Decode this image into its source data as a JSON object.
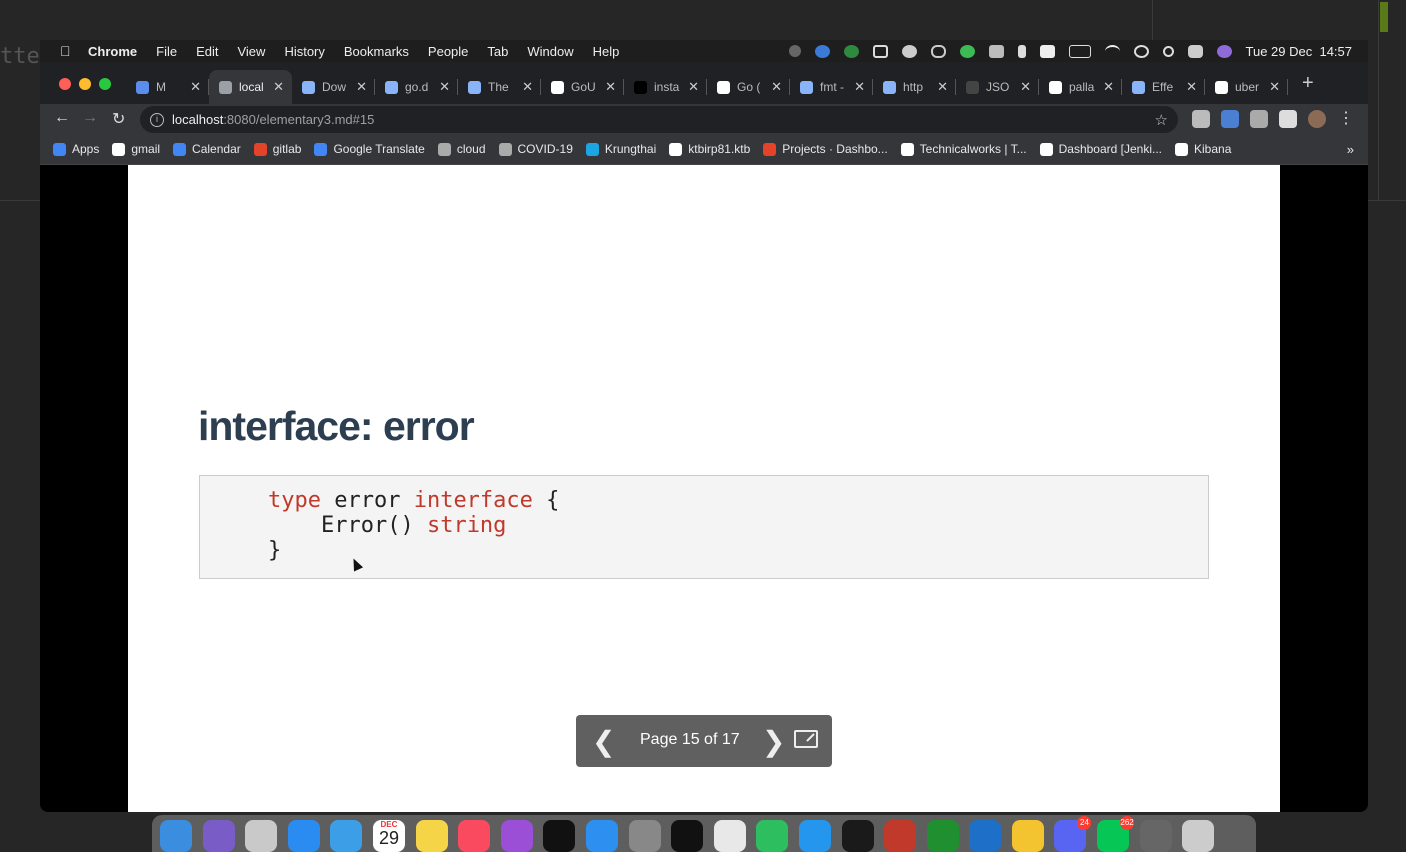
{
  "background": {
    "editor_text": "tte"
  },
  "menubar": {
    "app_name": "Chrome",
    "items": [
      "File",
      "Edit",
      "View",
      "History",
      "Bookmarks",
      "People",
      "Tab",
      "Window",
      "Help"
    ],
    "clock": "Tue 29 Dec  14:57"
  },
  "tabs": [
    {
      "label": "M",
      "favicon_color": "#5b8def",
      "active": false
    },
    {
      "label": "local",
      "favicon_color": "#9aa0a6",
      "active": true
    },
    {
      "label": "Dow",
      "favicon_color": "#8ab4f8",
      "active": false
    },
    {
      "label": "go.d",
      "favicon_color": "#8ab4f8",
      "active": false
    },
    {
      "label": "The",
      "favicon_color": "#8ab4f8",
      "active": false
    },
    {
      "label": "GoU",
      "favicon_color": "#ffffff",
      "active": false
    },
    {
      "label": "insta",
      "favicon_color": "#000000",
      "active": false
    },
    {
      "label": "Go (",
      "favicon_color": "#ffffff",
      "active": false
    },
    {
      "label": "fmt -",
      "favicon_color": "#8ab4f8",
      "active": false
    },
    {
      "label": "http",
      "favicon_color": "#8ab4f8",
      "active": false
    },
    {
      "label": "JSO",
      "favicon_color": "#444444",
      "active": false
    },
    {
      "label": "palla",
      "favicon_color": "#ffffff",
      "active": false
    },
    {
      "label": "Effe",
      "favicon_color": "#8ab4f8",
      "active": false
    },
    {
      "label": "uber",
      "favicon_color": "#ffffff",
      "active": false
    }
  ],
  "omnibox": {
    "host": "localhost",
    "path": ":8080/elementary3.md#15"
  },
  "bookmarks": [
    {
      "label": "Apps",
      "color": "#4285f4"
    },
    {
      "label": "gmail",
      "color": "#ffffff"
    },
    {
      "label": "Calendar",
      "color": "#4285f4"
    },
    {
      "label": "gitlab",
      "color": "#e24329"
    },
    {
      "label": "Google Translate",
      "color": "#4285f4"
    },
    {
      "label": "cloud",
      "color": "#aaaaaa"
    },
    {
      "label": "COVID-19",
      "color": "#aaaaaa"
    },
    {
      "label": "Krungthai",
      "color": "#1ba5e1"
    },
    {
      "label": "ktbirp81.ktb",
      "color": "#ffffff"
    },
    {
      "label": "Projects · Dashbo...",
      "color": "#e24329"
    },
    {
      "label": "Technicalworks | T...",
      "color": "#ffffff"
    },
    {
      "label": "Dashboard [Jenki...",
      "color": "#ffffff"
    },
    {
      "label": "Kibana",
      "color": "#ffffff"
    }
  ],
  "slide": {
    "title": "interface: error",
    "code": {
      "line1_kw1": "type",
      "line1_name": " error ",
      "line1_kw2": "interface",
      "line1_brace": " {",
      "line2_method": "    Error() ",
      "line2_type": "string",
      "line3": "}"
    }
  },
  "pager": {
    "label": "Page 15 of 17",
    "current": 15,
    "total": 17
  },
  "dock": {
    "calendar_month": "DEC",
    "calendar_day": "29",
    "discord_badge": "24",
    "line_badge": "262",
    "icons": [
      {
        "name": "finder",
        "color": "#3b8de0"
      },
      {
        "name": "siri",
        "color": "#7a5cc7"
      },
      {
        "name": "launchpad",
        "color": "#c9c9c9"
      },
      {
        "name": "safari",
        "color": "#2a8cf0"
      },
      {
        "name": "mail",
        "color": "#3d9ee8"
      },
      {
        "name": "calendar",
        "color": "#ffffff"
      },
      {
        "name": "notes",
        "color": "#f5d547"
      },
      {
        "name": "music",
        "color": "#fa4a5f"
      },
      {
        "name": "podcasts",
        "color": "#9a4fd6"
      },
      {
        "name": "tv",
        "color": "#111111"
      },
      {
        "name": "app-store",
        "color": "#2d8ff0"
      },
      {
        "name": "system-preferences",
        "color": "#888888"
      },
      {
        "name": "terminal",
        "color": "#111111"
      },
      {
        "name": "chrome",
        "color": "#e8e8e8"
      },
      {
        "name": "evernote",
        "color": "#2dbe60"
      },
      {
        "name": "docker",
        "color": "#2496ed"
      },
      {
        "name": "spark",
        "color": "#1a1a1a"
      },
      {
        "name": "bear",
        "color": "#c0392b"
      },
      {
        "name": "jetbrains",
        "color": "#1f8f2f"
      },
      {
        "name": "vscode",
        "color": "#1e6fc8"
      },
      {
        "name": "reminders",
        "color": "#f4c430"
      },
      {
        "name": "discord",
        "color": "#5865f2"
      },
      {
        "name": "line",
        "color": "#06c755"
      },
      {
        "name": "downloads",
        "color": "#666666"
      },
      {
        "name": "trash",
        "color": "#cccccc"
      }
    ]
  }
}
